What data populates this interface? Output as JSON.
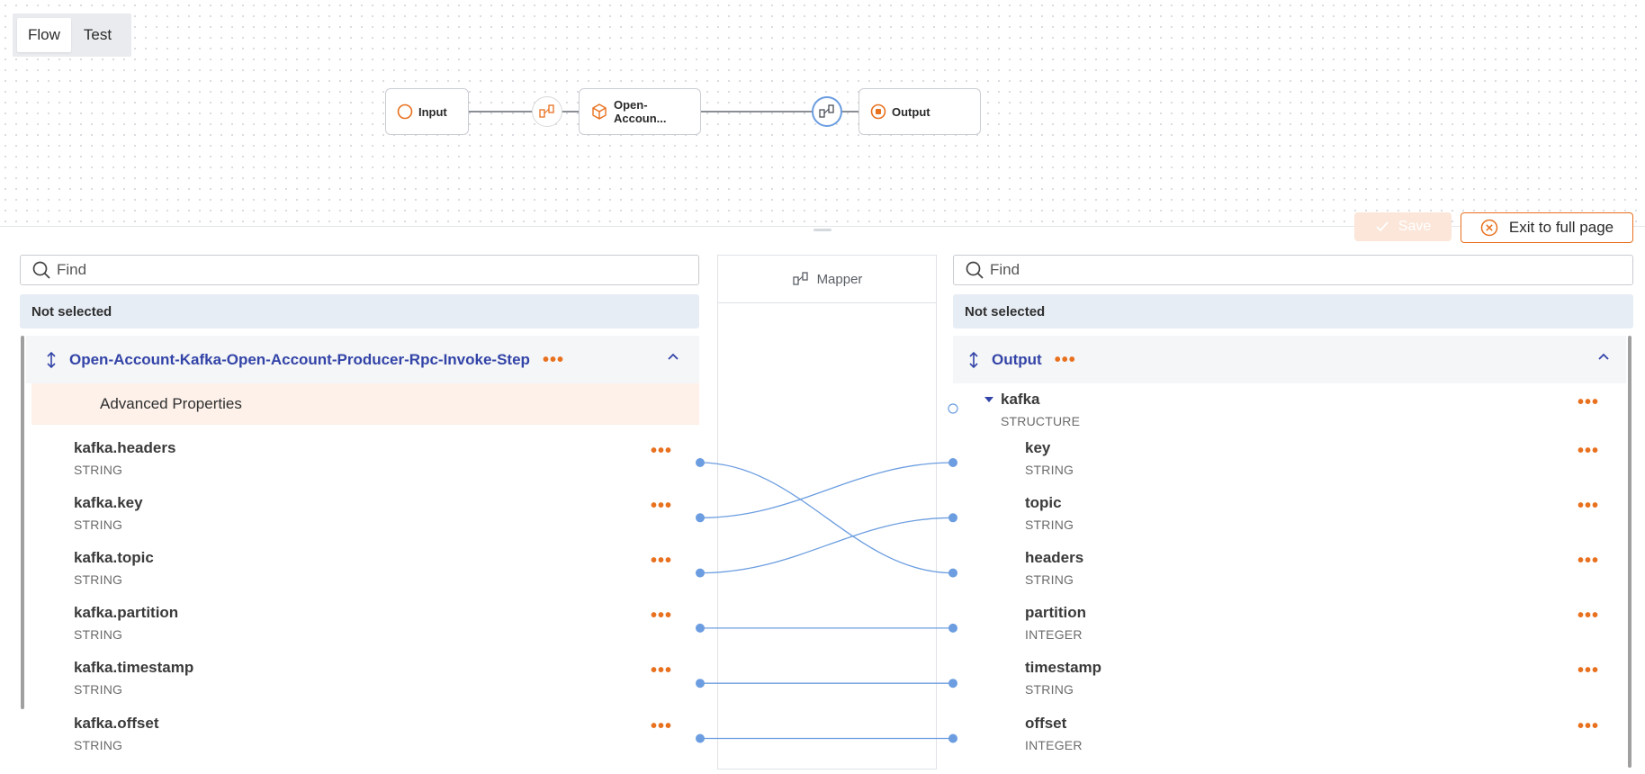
{
  "tabs": [
    {
      "label": "Flow",
      "active": true
    },
    {
      "label": "Test",
      "active": false
    }
  ],
  "flow": {
    "input_node": "Input",
    "step_node": "Open-Accoun...",
    "output_node": "Output"
  },
  "toolbar": {
    "save_label": "Save",
    "exit_label": "Exit to full page"
  },
  "colors": {
    "accent": "#e8711f",
    "link": "#6b9de0",
    "header_title": "#3344a8"
  },
  "left": {
    "search_placeholder": "Find",
    "selection": "Not selected",
    "header": "Open-Account-Kafka-Open-Account-Producer-Rpc-Invoke-Step",
    "advanced": "Advanced Properties",
    "fields": [
      {
        "name": "kafka.headers",
        "type": "STRING"
      },
      {
        "name": "kafka.key",
        "type": "STRING"
      },
      {
        "name": "kafka.topic",
        "type": "STRING"
      },
      {
        "name": "kafka.partition",
        "type": "STRING"
      },
      {
        "name": "kafka.timestamp",
        "type": "STRING"
      },
      {
        "name": "kafka.offset",
        "type": "STRING"
      }
    ]
  },
  "mapper": {
    "label": "Mapper"
  },
  "right": {
    "search_placeholder": "Find",
    "selection": "Not selected",
    "header": "Output",
    "group": {
      "name": "kafka",
      "type": "STRUCTURE"
    },
    "fields": [
      {
        "name": "key",
        "type": "STRING"
      },
      {
        "name": "topic",
        "type": "STRING"
      },
      {
        "name": "headers",
        "type": "STRING"
      },
      {
        "name": "partition",
        "type": "INTEGER"
      },
      {
        "name": "timestamp",
        "type": "STRING"
      },
      {
        "name": "offset",
        "type": "INTEGER"
      }
    ]
  },
  "mappings": [
    {
      "from": "kafka.headers",
      "to": "headers"
    },
    {
      "from": "kafka.key",
      "to": "key"
    },
    {
      "from": "kafka.topic",
      "to": "topic"
    },
    {
      "from": "kafka.partition",
      "to": "partition"
    },
    {
      "from": "kafka.timestamp",
      "to": "timestamp"
    },
    {
      "from": "kafka.offset",
      "to": "offset"
    }
  ]
}
